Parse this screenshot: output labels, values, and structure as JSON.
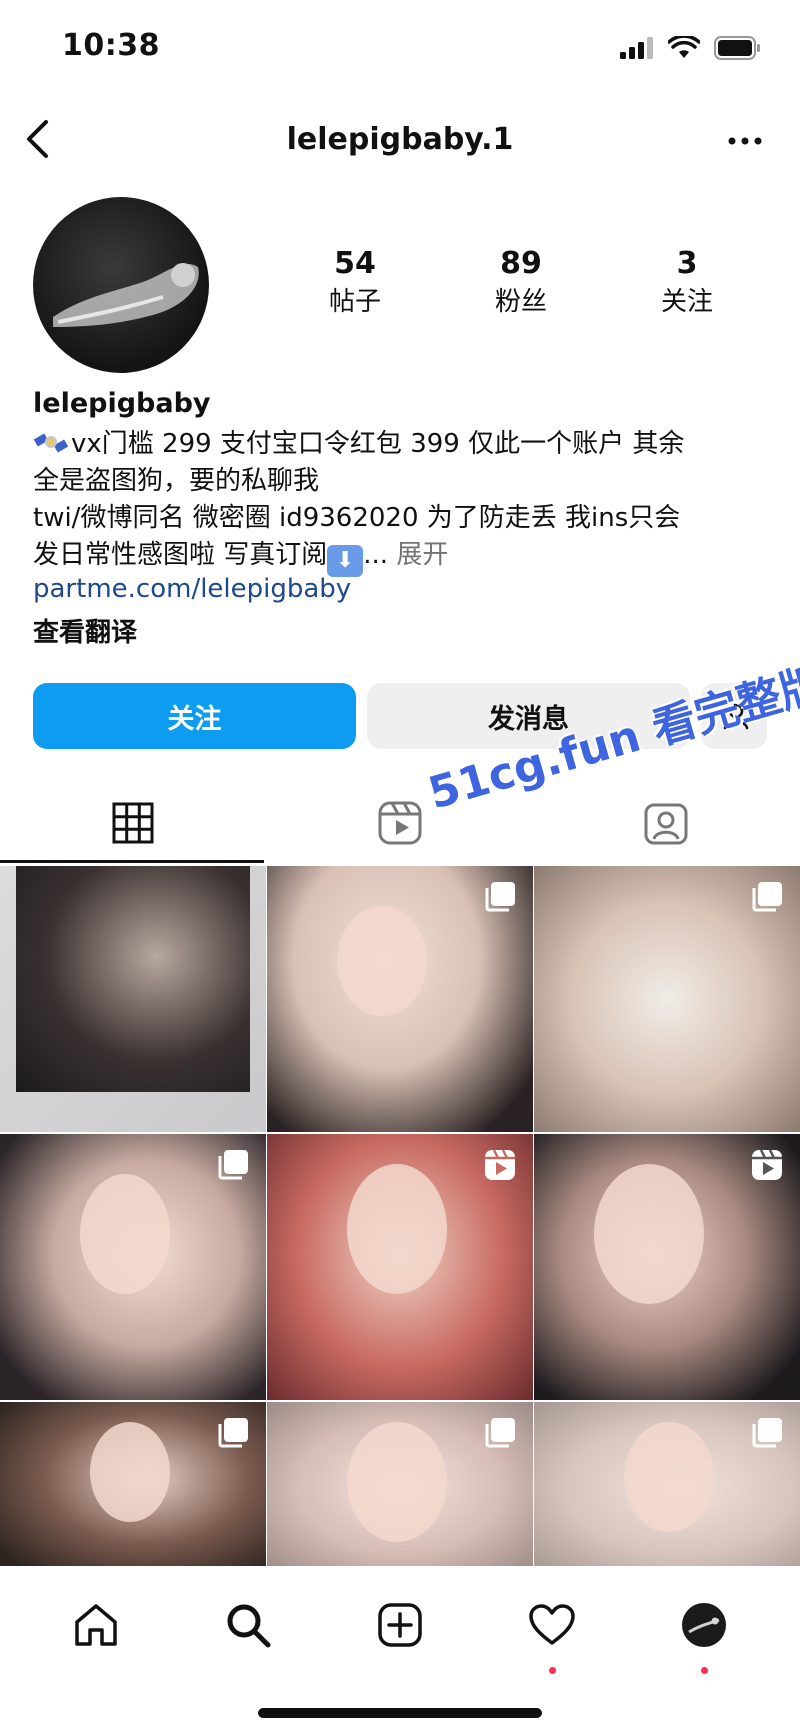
{
  "status_bar": {
    "time": "10:38"
  },
  "nav": {
    "username": "lelepigbaby.1"
  },
  "profile": {
    "name": "lelepigbaby",
    "stats": [
      {
        "value": "54",
        "label": "帖子"
      },
      {
        "value": "89",
        "label": "粉丝"
      },
      {
        "value": "3",
        "label": "关注"
      }
    ],
    "bio_lines": [
      "vx门槛 299 支付宝口令红包 399 仅此一个账户 其余",
      "全是盗图狗，要的私聊我",
      "twi/微博同名 微密圈 id9362020 为了防走丢 我ins只会",
      "发日常性感图啦 写真订阅"
    ],
    "bio_ellipsis": "...",
    "expand_label": "展开",
    "link": "partme.com/lelepigbaby",
    "translate_label": "查看翻译"
  },
  "actions": {
    "follow_label": "关注",
    "message_label": "发消息"
  },
  "watermark": "51cg.fun 看完整版",
  "tabs": [
    {
      "icon": "grid-icon",
      "active": true
    },
    {
      "icon": "reels-icon",
      "active": false
    },
    {
      "icon": "tagged-icon",
      "active": false
    }
  ],
  "posts": [
    {
      "badge": "none"
    },
    {
      "badge": "carousel-icon"
    },
    {
      "badge": "carousel-icon"
    },
    {
      "badge": "carousel-icon"
    },
    {
      "badge": "reel-icon"
    },
    {
      "badge": "reel-icon"
    },
    {
      "badge": "carousel-icon"
    },
    {
      "badge": "carousel-icon"
    },
    {
      "badge": "carousel-icon"
    }
  ],
  "bottom_nav": [
    {
      "icon": "home-icon"
    },
    {
      "icon": "search-icon"
    },
    {
      "icon": "create-icon"
    },
    {
      "icon": "heart-icon",
      "notification": true
    },
    {
      "icon": "profile-avatar",
      "notification": true
    }
  ],
  "colors": {
    "accent": "#0d9cf0",
    "secondary_button": "#efefef",
    "link": "#1e4a8d",
    "watermark": "#3f64e0",
    "notification": "#ff2d55"
  }
}
